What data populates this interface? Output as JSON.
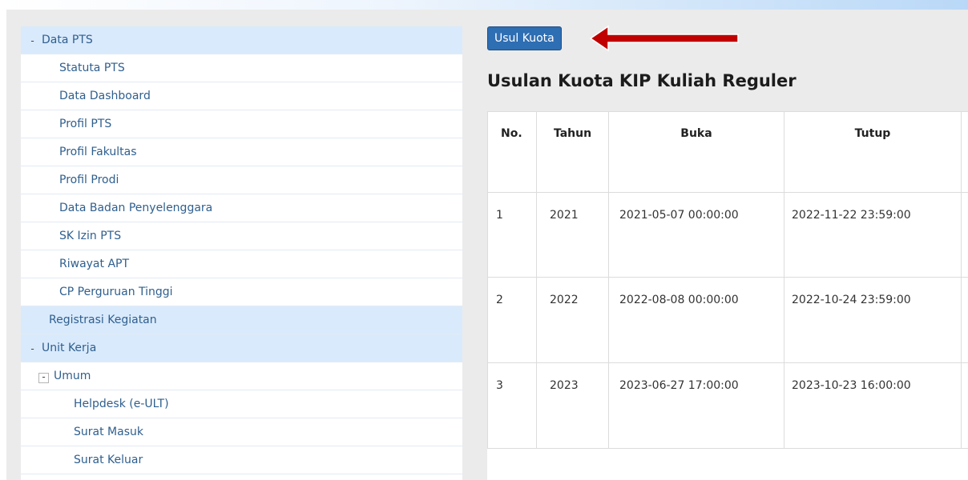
{
  "sidebar": {
    "items": [
      {
        "label": "Data PTS",
        "toggle": "-"
      },
      {
        "label": "Statuta PTS"
      },
      {
        "label": "Data Dashboard"
      },
      {
        "label": "Profil PTS"
      },
      {
        "label": "Profil Fakultas"
      },
      {
        "label": "Profil Prodi"
      },
      {
        "label": "Data Badan Penyelenggara"
      },
      {
        "label": "SK Izin PTS"
      },
      {
        "label": "Riwayat APT"
      },
      {
        "label": "CP Perguruan Tinggi"
      },
      {
        "label": "Registrasi Kegiatan"
      },
      {
        "label": "Unit Kerja",
        "toggle": "-"
      },
      {
        "label": "Umum",
        "toggle": "-"
      },
      {
        "label": "Helpdesk (e-ULT)"
      },
      {
        "label": "Surat Masuk"
      },
      {
        "label": "Surat Keluar"
      }
    ]
  },
  "main": {
    "button_label": "Usul Kuota",
    "title": "Usulan Kuota KIP Kuliah Reguler",
    "table": {
      "headers": [
        "No.",
        "Tahun",
        "Buka",
        "Tutup"
      ],
      "rows": [
        {
          "no": "1",
          "tahun": "2021",
          "buka": "2021-05-07 00:00:00",
          "tutup": "2022-11-22 23:59:00"
        },
        {
          "no": "2",
          "tahun": "2022",
          "buka": "2022-08-08 00:00:00",
          "tutup": "2022-10-24 23:59:00"
        },
        {
          "no": "3",
          "tahun": "2023",
          "buka": "2023-06-27 17:00:00",
          "tutup": "2023-10-23 16:00:00"
        }
      ]
    }
  },
  "annotation": {
    "arrow_color": "#c00000"
  },
  "colors": {
    "link": "#2f5f8e",
    "button": "#2e6eb3",
    "highlight": "#d9eafc"
  }
}
